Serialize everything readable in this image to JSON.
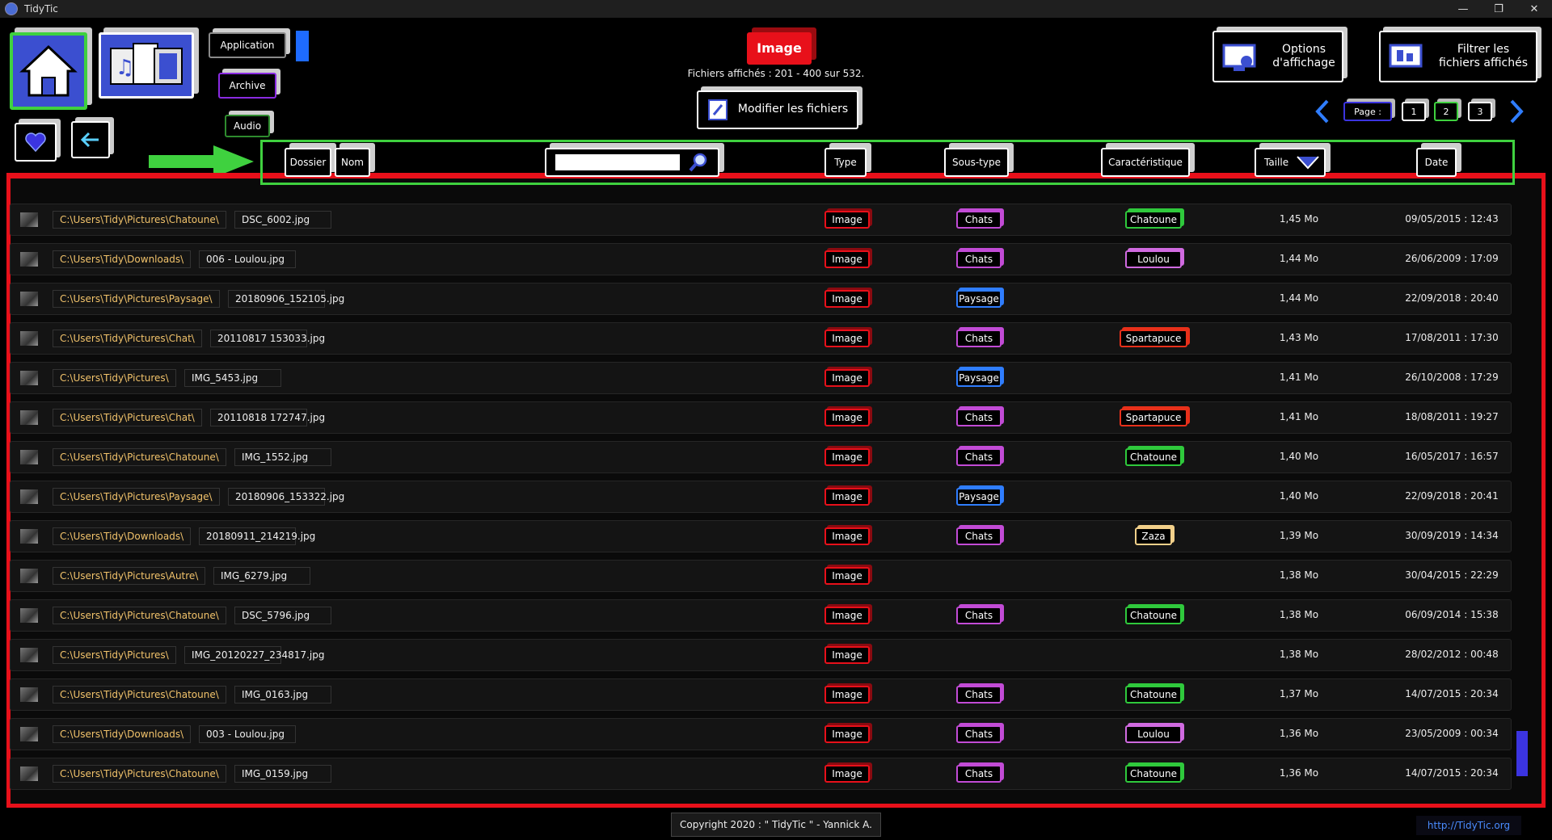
{
  "window": {
    "title": "TidyTic",
    "controls": [
      "—",
      "❐",
      "✕"
    ]
  },
  "nav": {
    "categories": [
      {
        "label": "Application",
        "border": "#8a8a8a"
      },
      {
        "label": "Archive",
        "border": "#8a2be2"
      },
      {
        "label": "Audio",
        "border": "#2e8b2e"
      }
    ]
  },
  "filter": {
    "active_type": "Image",
    "info": "Fichiers affichés : 201 - 400 sur 532."
  },
  "actions": {
    "modify_files": "Modifier les fichiers",
    "display_options": "Options\nd'affichage",
    "filter_files": "Filtrer les\nfichiers affichés"
  },
  "pager": {
    "label": "Page :",
    "pages": [
      "1",
      "2",
      "3"
    ]
  },
  "columns": {
    "folder": "Dossier",
    "name": "Nom",
    "type": "Type",
    "subtype": "Sous-type",
    "characteristic": "Caractéristique",
    "size": "Taille",
    "date": "Date"
  },
  "search": {
    "value": ""
  },
  "colors": {
    "Chats": "#c24bd6",
    "Paysage": "#2f7dff",
    "Chatoune": "#2fc93c",
    "Loulou": "#d06ae0",
    "Spartapuce": "#e8301a",
    "Zaza": "#f2d08a"
  },
  "rows": [
    {
      "folder": "C:\\Users\\Tidy\\Pictures\\Chatoune\\",
      "name": "DSC_6002.jpg",
      "type": "Image",
      "subtype": "Chats",
      "characteristic": "Chatoune",
      "size": "1,45 Mo",
      "date": "09/05/2015 : 12:43"
    },
    {
      "folder": "C:\\Users\\Tidy\\Downloads\\",
      "name": "006 - Loulou.jpg",
      "type": "Image",
      "subtype": "Chats",
      "characteristic": "Loulou",
      "size": "1,44 Mo",
      "date": "26/06/2009 : 17:09"
    },
    {
      "folder": "C:\\Users\\Tidy\\Pictures\\Paysage\\",
      "name": "20180906_152105.jpg",
      "type": "Image",
      "subtype": "Paysage",
      "characteristic": "",
      "size": "1,44 Mo",
      "date": "22/09/2018 : 20:40"
    },
    {
      "folder": "C:\\Users\\Tidy\\Pictures\\Chat\\",
      "name": "20110817 153033.jpg",
      "type": "Image",
      "subtype": "Chats",
      "characteristic": "Spartapuce",
      "size": "1,43 Mo",
      "date": "17/08/2011 : 17:30"
    },
    {
      "folder": "C:\\Users\\Tidy\\Pictures\\",
      "name": "IMG_5453.jpg",
      "type": "Image",
      "subtype": "Paysage",
      "characteristic": "",
      "size": "1,41 Mo",
      "date": "26/10/2008 : 17:29"
    },
    {
      "folder": "C:\\Users\\Tidy\\Pictures\\Chat\\",
      "name": "20110818 172747.jpg",
      "type": "Image",
      "subtype": "Chats",
      "characteristic": "Spartapuce",
      "size": "1,41 Mo",
      "date": "18/08/2011 : 19:27"
    },
    {
      "folder": "C:\\Users\\Tidy\\Pictures\\Chatoune\\",
      "name": "IMG_1552.jpg",
      "type": "Image",
      "subtype": "Chats",
      "characteristic": "Chatoune",
      "size": "1,40 Mo",
      "date": "16/05/2017 : 16:57"
    },
    {
      "folder": "C:\\Users\\Tidy\\Pictures\\Paysage\\",
      "name": "20180906_153322.jpg",
      "type": "Image",
      "subtype": "Paysage",
      "characteristic": "",
      "size": "1,40 Mo",
      "date": "22/09/2018 : 20:41"
    },
    {
      "folder": "C:\\Users\\Tidy\\Downloads\\",
      "name": "20180911_214219.jpg",
      "type": "Image",
      "subtype": "Chats",
      "characteristic": "Zaza",
      "size": "1,39 Mo",
      "date": "30/09/2019 : 14:34"
    },
    {
      "folder": "C:\\Users\\Tidy\\Pictures\\Autre\\",
      "name": "IMG_6279.jpg",
      "type": "Image",
      "subtype": "",
      "characteristic": "",
      "size": "1,38 Mo",
      "date": "30/04/2015 : 22:29"
    },
    {
      "folder": "C:\\Users\\Tidy\\Pictures\\Chatoune\\",
      "name": "DSC_5796.jpg",
      "type": "Image",
      "subtype": "Chats",
      "characteristic": "Chatoune",
      "size": "1,38 Mo",
      "date": "06/09/2014 : 15:38"
    },
    {
      "folder": "C:\\Users\\Tidy\\Pictures\\",
      "name": "IMG_20120227_234817.jpg",
      "type": "Image",
      "subtype": "",
      "characteristic": "",
      "size": "1,38 Mo",
      "date": "28/02/2012 : 00:48"
    },
    {
      "folder": "C:\\Users\\Tidy\\Pictures\\Chatoune\\",
      "name": "IMG_0163.jpg",
      "type": "Image",
      "subtype": "Chats",
      "characteristic": "Chatoune",
      "size": "1,37 Mo",
      "date": "14/07/2015 : 20:34"
    },
    {
      "folder": "C:\\Users\\Tidy\\Downloads\\",
      "name": "003 - Loulou.jpg",
      "type": "Image",
      "subtype": "Chats",
      "characteristic": "Loulou",
      "size": "1,36 Mo",
      "date": "23/05/2009 : 00:34"
    },
    {
      "folder": "C:\\Users\\Tidy\\Pictures\\Chatoune\\",
      "name": "IMG_0159.jpg",
      "type": "Image",
      "subtype": "Chats",
      "characteristic": "Chatoune",
      "size": "1,36 Mo",
      "date": "14/07/2015 : 20:34"
    }
  ],
  "footer": {
    "copyright": "Copyright 2020 : \" TidyTic \" - Yannick A.",
    "link": "http://TidyTic.org"
  }
}
